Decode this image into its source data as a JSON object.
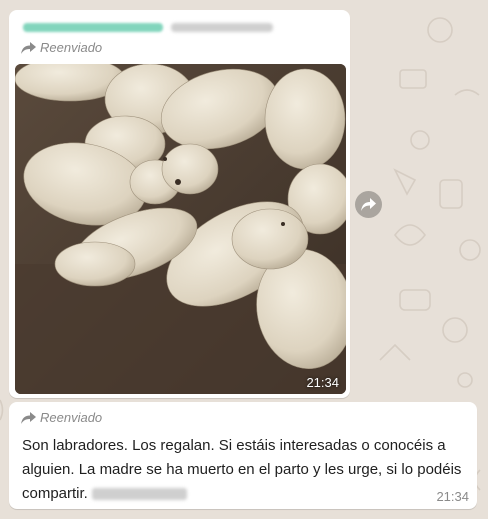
{
  "chat": {
    "message_1": {
      "sender_name": "",
      "forwarded_label": "Reenviado",
      "photo_time": "21:34",
      "photo_icon": "image-puppies"
    },
    "message_2": {
      "forwarded_label": "Reenviado",
      "text": "Son labradores. Los regalan. Si estáis interesadas o conocéis a alguien. La madre se ha muerto en el parto y les urge, si lo podéis compartir.",
      "time": "21:34"
    },
    "share_button_icon": "forward-arrow-icon"
  },
  "colors": {
    "wallpaper": "#e7e0d8",
    "bubble": "#ffffff",
    "sender_blur": "#58c7a6",
    "meta_text": "#8a8a8a"
  }
}
